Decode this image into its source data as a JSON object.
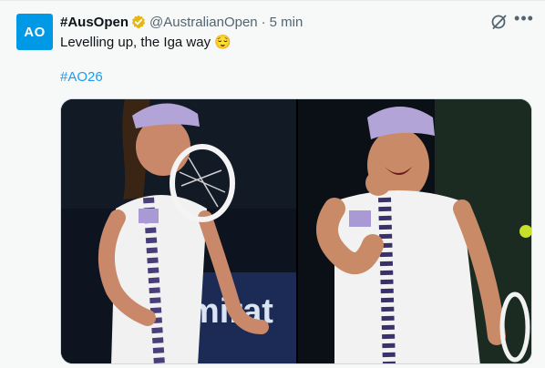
{
  "tweet": {
    "author_name": "#AusOpen",
    "author_handle": "@AustralianOpen",
    "separator": "·",
    "timestamp": "5 min",
    "avatar_text": "AO",
    "text": "Levelling up, the Iga way 😌",
    "hashtag": "#AO26",
    "more_icon": "more-icon",
    "grok_icon": "grok-icon",
    "badge_icon": "verified-badge-icon",
    "colors": {
      "avatar_bg": "#0099e6",
      "link": "#1d9bf0",
      "badge": "#e2b719"
    }
  },
  "media": {
    "left_image_alt": "Player on court holding racquet",
    "right_image_alt": "Player celebrating with fist pump",
    "left_banner_text": "mirat"
  }
}
